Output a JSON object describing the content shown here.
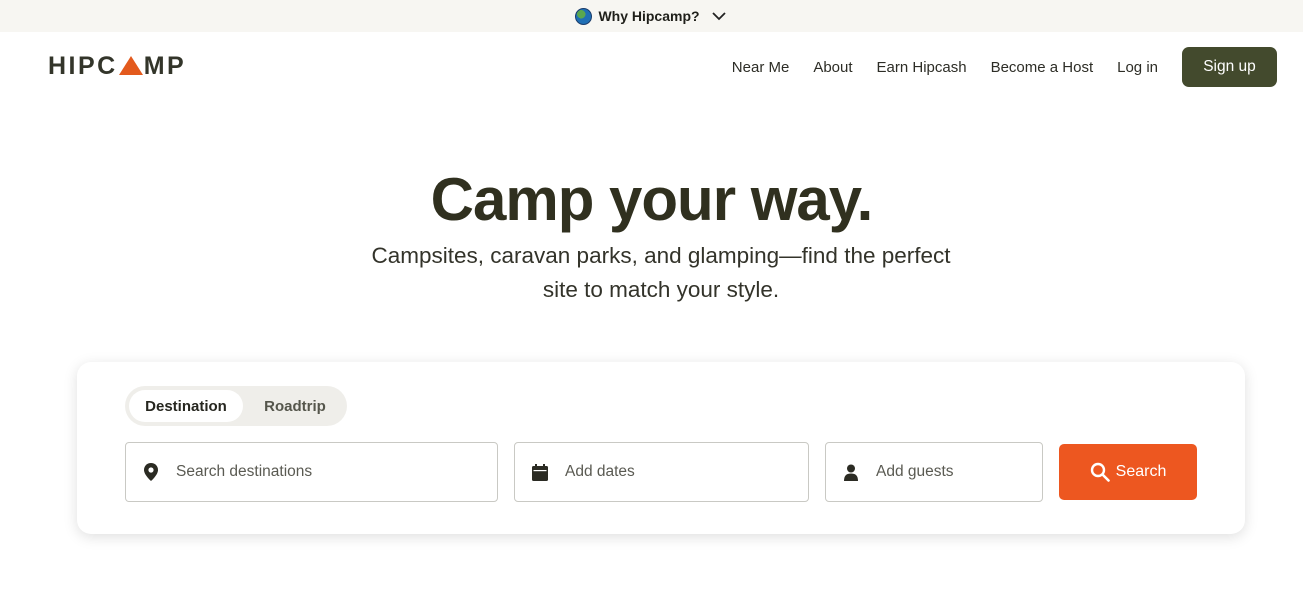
{
  "banner": {
    "label": "Why Hipcamp?",
    "globe_icon": "globe-icon",
    "chevron_icon": "chevron-down-icon"
  },
  "header": {
    "logo_text_left": "HIPC",
    "logo_text_right": "MP",
    "nav": [
      {
        "label": "Near Me"
      },
      {
        "label": "About"
      },
      {
        "label": "Earn Hipcash"
      },
      {
        "label": "Become a Host"
      },
      {
        "label": "Log in"
      }
    ],
    "signup_label": "Sign up"
  },
  "hero": {
    "title": "Camp your way.",
    "subtitle": "Campsites, caravan parks, and glamping—find the perfect site to match your style."
  },
  "search": {
    "tabs": [
      {
        "label": "Destination",
        "active": true
      },
      {
        "label": "Roadtrip",
        "active": false
      }
    ],
    "destination_placeholder": "Search destinations",
    "dates_placeholder": "Add dates",
    "guests_placeholder": "Add guests",
    "button_label": "Search"
  },
  "colors": {
    "brand_orange": "#ed5720",
    "signup_green": "#434a2d",
    "text_dark": "#30301f"
  }
}
